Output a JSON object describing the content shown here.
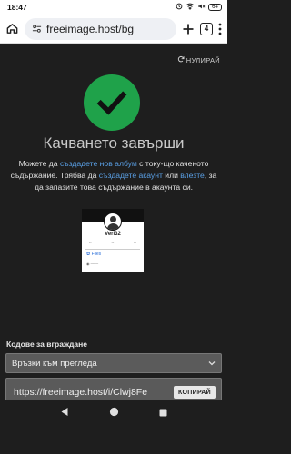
{
  "status_bar": {
    "time": "18:47",
    "battery": "64"
  },
  "browser": {
    "url": "freeimage.host/bg",
    "tab_count": "4"
  },
  "page": {
    "reset_label": "НУЛИРАЙ",
    "title": "Качването завърши",
    "desc": {
      "p1": "Можете да ",
      "link_album": "създадете нов албум",
      "p2": " с току-що каченото съдържание. Трябва да ",
      "link_account": "създадете акаунт",
      "p3": " или ",
      "link_login": "влезте",
      "p4": ", за да запазите това съдържание в акаунта си."
    },
    "thumbnail": {
      "name": "Veri32",
      "files_label": "Files"
    },
    "embed": {
      "label": "Кодове за вграждане",
      "select_value": "Връзки към прегледа",
      "code_value": "https://freeimage.host/i/Clwj8Fe",
      "copy_label": "КОПИРАЙ"
    }
  },
  "colors": {
    "success": "#1fa24a",
    "link": "#5aa0e6",
    "background": "#1e1e1e"
  }
}
